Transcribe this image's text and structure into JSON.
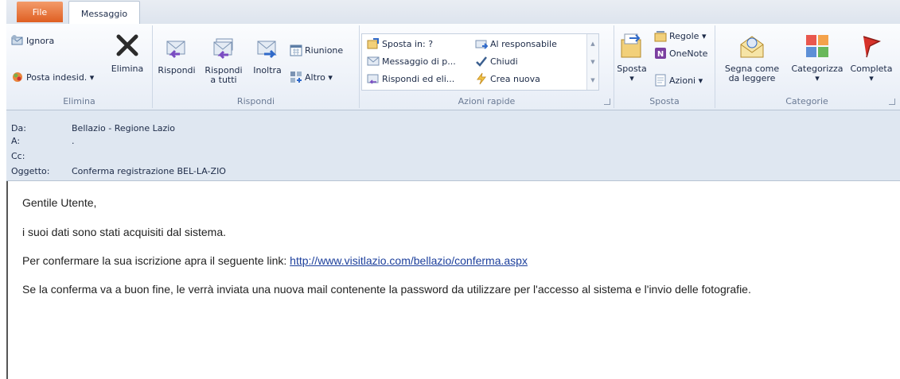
{
  "tabs": {
    "file": "File",
    "message": "Messaggio"
  },
  "ribbon": {
    "elimina": {
      "ignore": "Ignora",
      "junk": "Posta indesid. ▾",
      "delete": "Elimina",
      "group_label": "Elimina"
    },
    "rispondi": {
      "reply": "Rispondi",
      "reply_all_1": "Rispondi",
      "reply_all_2": "a tutti",
      "forward": "Inoltra",
      "meeting": "Riunione",
      "more": "Altro ▾",
      "group_label": "Rispondi"
    },
    "azioni_rapide": {
      "items": [
        "Sposta in: ?",
        "Al responsabile",
        "Messaggio di p...",
        "Chiudi",
        "Rispondi ed eli...",
        "Crea nuova"
      ],
      "group_label": "Azioni rapide"
    },
    "sposta": {
      "move": "Sposta",
      "move_arrow": "▾",
      "rules": "Regole ▾",
      "onenote": "OneNote",
      "actions": "Azioni ▾",
      "group_label": "Sposta"
    },
    "categorie": {
      "mark_1": "Segna come",
      "mark_2": "da leggere",
      "categorize": "Categorizza",
      "complete": "Completa",
      "arrow": "▾",
      "group_label": "Categorie"
    }
  },
  "header": {
    "from_label": "Da:",
    "from_value": "Bellazio - Regione Lazio",
    "to_label": "A:",
    "to_value": ".",
    "cc_label": "Cc:",
    "subject_label": "Oggetto:",
    "subject_value": "Conferma registrazione BEL-LA-ZIO"
  },
  "body": {
    "greeting": "Gentile Utente,",
    "p1": "i suoi dati sono stati acquisiti dal sistema.",
    "p2_prefix": "Per confermare la sua iscrizione apra il seguente link: ",
    "p2_link": "http://www.visitlazio.com/bellazio/conferma.aspx",
    "p3": "Se la conferma va a buon fine, le verrà inviata una nuova mail contenente la password da utilizzare per l'accesso al sistema e l'invio delle fotografie."
  },
  "colors": {
    "file_tab": "#df5f22",
    "ribbon": "#e7edf6",
    "header": "#dfe7f1",
    "link": "#1c3f9c"
  }
}
